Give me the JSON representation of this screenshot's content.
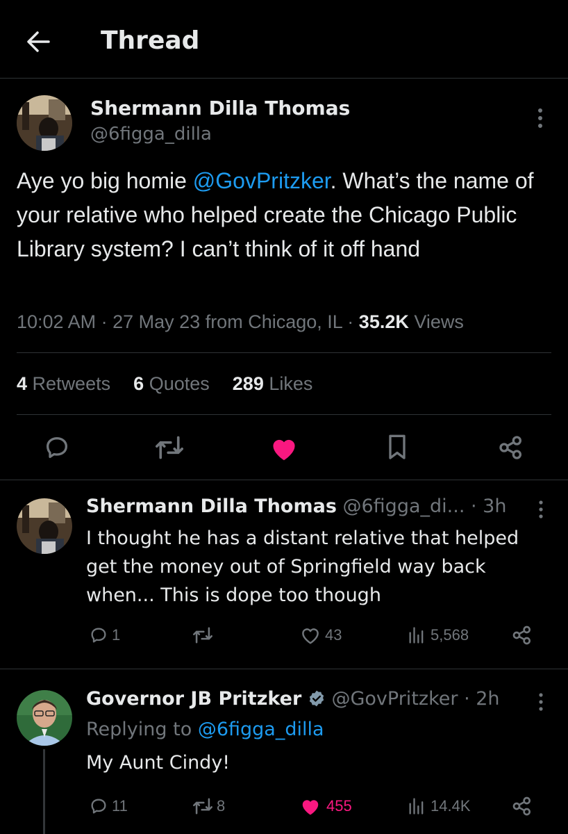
{
  "header": {
    "title": "Thread"
  },
  "main_tweet": {
    "author_name": "Shermann Dilla Thomas",
    "author_handle": "@6figga_dilla",
    "text_before": "Aye yo big homie ",
    "mention": "@GovPritzker",
    "text_after": ". What’s the name of your relative who helped create the Chicago Public Library system? I can’t think of it off hand",
    "time": "10:02 AM",
    "date": "27 May 23",
    "location": "from Chicago, IL",
    "views_count": "35.2K",
    "views_label": "Views",
    "retweets_count": "4",
    "retweets_label": "Retweets",
    "quotes_count": "6",
    "quotes_label": "Quotes",
    "likes_count": "289",
    "likes_label": "Likes"
  },
  "replies": [
    {
      "author_name": "Shermann Dilla Thomas",
      "author_handle": "@6figga_di...",
      "time": "· 3h",
      "text": "I thought he has a distant relative that helped get the money out of Springfield way back when... This is dope too though",
      "reply_count": "1",
      "retweet_count": "",
      "like_count": "43",
      "views": "5,568"
    },
    {
      "author_name": "Governor JB Pritzker",
      "author_handle": "@GovPritzker",
      "time": "· 2h",
      "replying_label": "Replying to",
      "replying_handle": "@6figga_dilla",
      "text": "My Aunt Cindy!",
      "reply_count": "11",
      "retweet_count": "8",
      "like_count": "455",
      "views": "14.4K"
    }
  ],
  "colors": {
    "background": "#000000",
    "text": "#e7e9ea",
    "muted": "#71767b",
    "link": "#1d9bf0",
    "like": "#f91880",
    "verified": "#829aab"
  },
  "icons": [
    "back-arrow-icon",
    "more-icon",
    "reply-icon",
    "retweet-icon",
    "like-icon",
    "bookmark-icon",
    "share-icon",
    "views-icon",
    "verified-icon"
  ]
}
